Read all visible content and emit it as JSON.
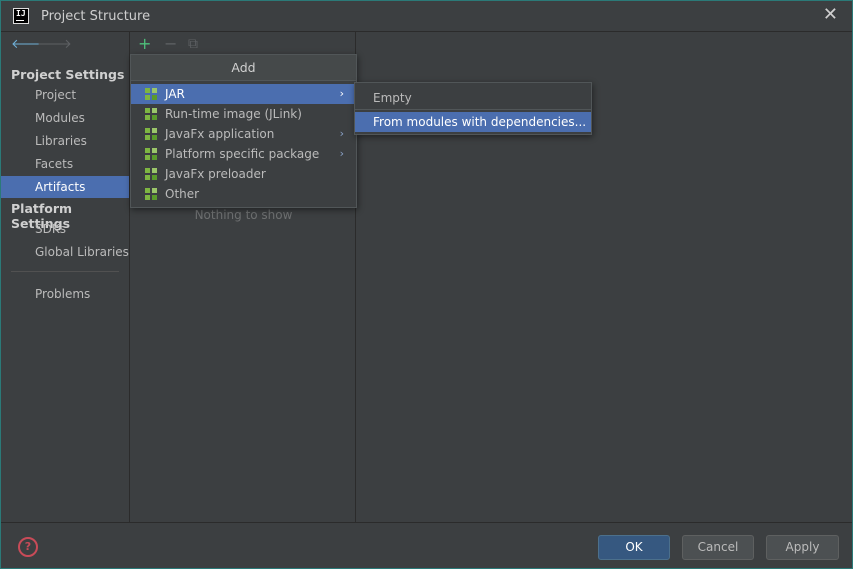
{
  "window": {
    "title": "Project Structure",
    "close_glyph": "✕"
  },
  "nav": {
    "back_glyph": "🡐",
    "forward_glyph": "🡒",
    "project_settings_header": "Project Settings",
    "project_settings_items": [
      "Project",
      "Modules",
      "Libraries",
      "Facets",
      "Artifacts"
    ],
    "selected_item": "Artifacts",
    "platform_settings_header": "Platform Settings",
    "platform_settings_items": [
      "SDKs",
      "Global Libraries"
    ],
    "problems": "Problems"
  },
  "toolbar": {
    "add_glyph": "+",
    "remove_glyph": "−",
    "copy_glyph": "⧉"
  },
  "artifacts_panel": {
    "empty_text": "Nothing to show"
  },
  "add_menu": {
    "header": "Add",
    "items": [
      {
        "label": "JAR",
        "has_submenu": true,
        "selected": true
      },
      {
        "label": "Run-time image (JLink)",
        "has_submenu": false
      },
      {
        "label": "JavaFx application",
        "has_submenu": true
      },
      {
        "label": "Platform specific package",
        "has_submenu": true
      },
      {
        "label": "JavaFx preloader",
        "has_submenu": false
      },
      {
        "label": "Other",
        "has_submenu": false
      }
    ],
    "submenu_arrow": "›"
  },
  "jar_submenu": {
    "items": [
      "Empty",
      "From modules with dependencies..."
    ],
    "selected": "From modules with dependencies..."
  },
  "footer": {
    "help_glyph": "?",
    "ok_label": "OK",
    "cancel_label": "Cancel",
    "apply_label": "Apply"
  },
  "colors": {
    "selection": "#4b6eaf",
    "background": "#3c3f41",
    "module_icon": "#7eb542",
    "help_icon": "#c84b58",
    "primary_button": "#365880"
  }
}
